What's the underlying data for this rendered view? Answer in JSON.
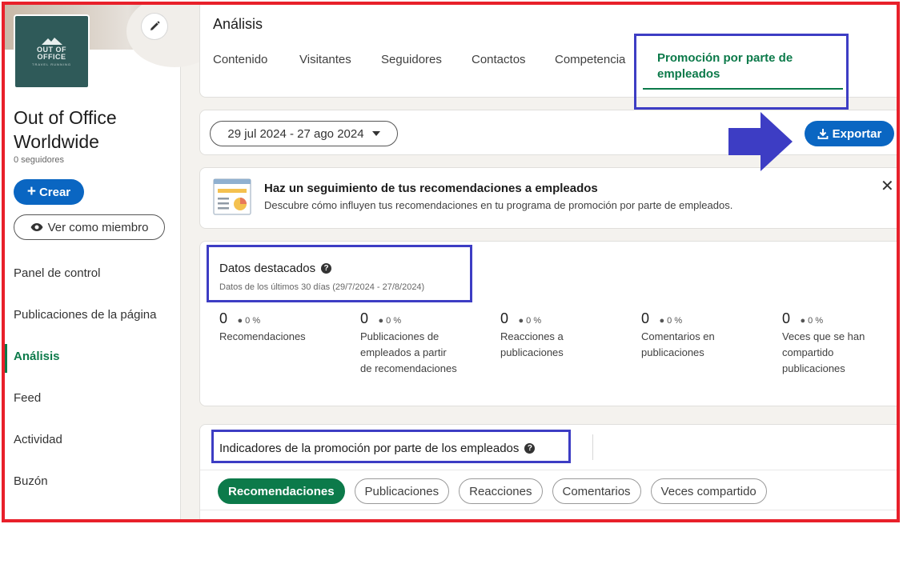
{
  "sidebar": {
    "logo": {
      "line1": "OUT OF",
      "line2": "OFFICE",
      "line3": "TRAVEL RUNNING"
    },
    "company_name": "Out of Office Worldwide",
    "followers": "0 seguidores",
    "create_label": "Crear",
    "view_member_label": "Ver como miembro",
    "nav": [
      {
        "label": "Panel de control"
      },
      {
        "label": "Publicaciones de la página"
      },
      {
        "label": "Análisis"
      },
      {
        "label": "Feed"
      },
      {
        "label": "Actividad"
      },
      {
        "label": "Buzón"
      }
    ]
  },
  "header": {
    "title": "Análisis",
    "tabs": [
      {
        "label": "Contenido"
      },
      {
        "label": "Visitantes"
      },
      {
        "label": "Seguidores"
      },
      {
        "label": "Contactos"
      },
      {
        "label": "Competencia"
      },
      {
        "label": "Promoción por parte de empleados"
      }
    ]
  },
  "toolbar": {
    "date_range": "29 jul 2024 - 27 ago 2024",
    "export_label": "Exportar"
  },
  "banner": {
    "title": "Haz un seguimiento de tus recomendaciones a empleados",
    "description": "Descubre cómo influyen tus recomendaciones en tu programa de promoción por parte de empleados."
  },
  "highlights": {
    "title": "Datos destacados",
    "subtitle": "Datos de los últimos 30 días (29/7/2024 - 27/8/2024)",
    "metrics": [
      {
        "value": "0",
        "change": "0 %",
        "label": "Recomendaciones"
      },
      {
        "value": "0",
        "change": "0 %",
        "label": "Publicaciones de empleados a partir de recomendaciones"
      },
      {
        "value": "0",
        "change": "0 %",
        "label": "Reacciones a publicaciones"
      },
      {
        "value": "0",
        "change": "0 %",
        "label": "Comentarios en publicaciones"
      },
      {
        "value": "0",
        "change": "0 %",
        "label": "Veces que se han compartido publicaciones"
      }
    ]
  },
  "indicators": {
    "title": "Indicadores de la promoción por parte de los empleados",
    "pills": [
      {
        "label": "Recomendaciones"
      },
      {
        "label": "Publicaciones"
      },
      {
        "label": "Reacciones"
      },
      {
        "label": "Comentarios"
      },
      {
        "label": "Veces compartido"
      }
    ]
  },
  "colors": {
    "accent_green": "#0c7a4a",
    "button_blue": "#0a66c2",
    "annotation_red": "#e8202a",
    "annotation_blue": "#3d3dc4"
  }
}
